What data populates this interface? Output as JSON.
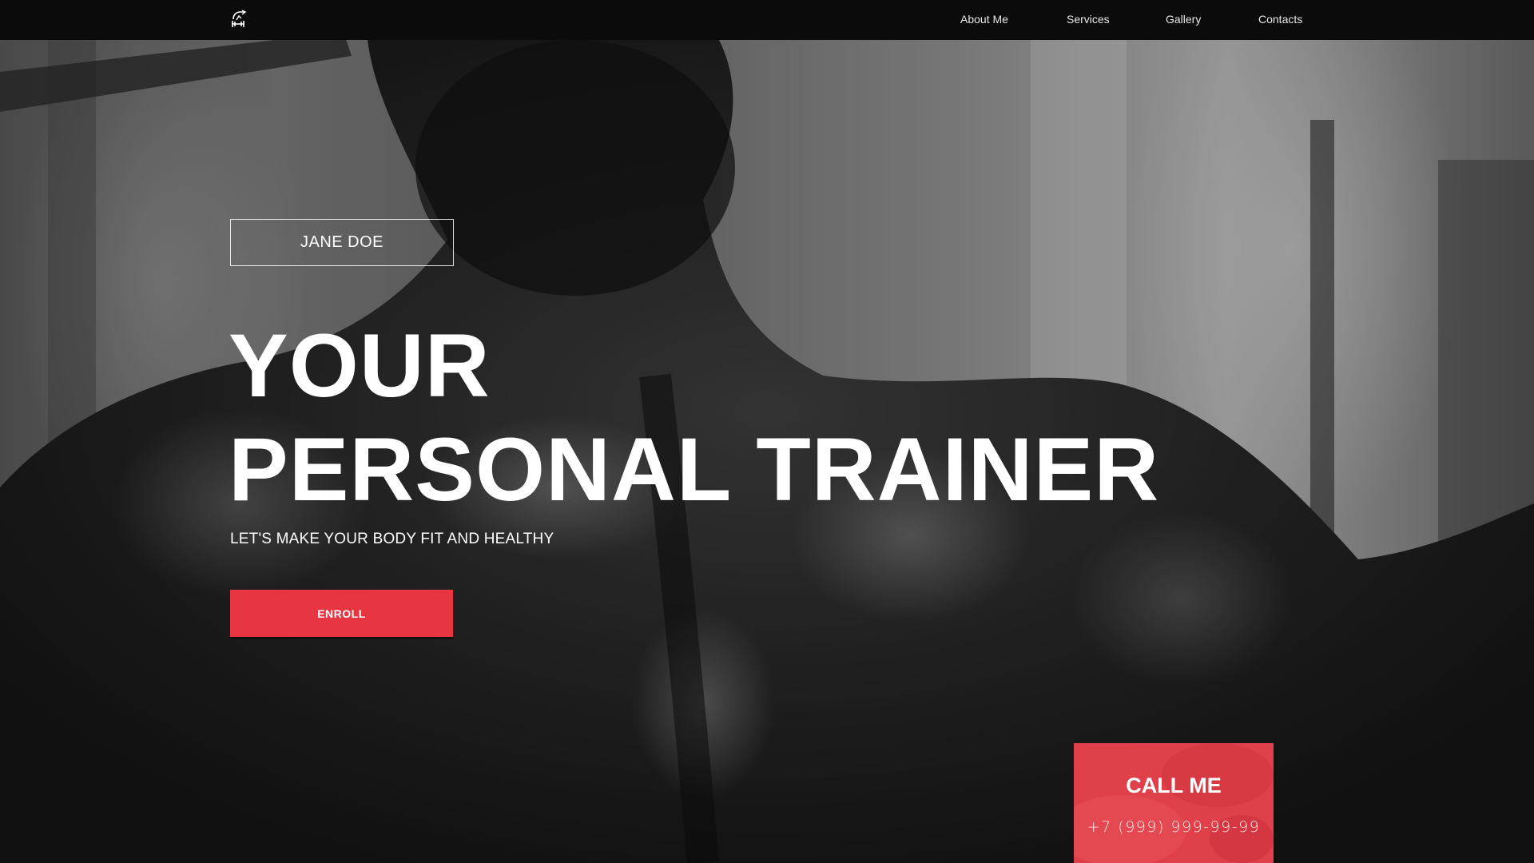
{
  "nav": {
    "logo_icon": "dumbbell-logo-icon",
    "links": [
      "About Me",
      "Services",
      "Gallery",
      "Contacts"
    ]
  },
  "hero": {
    "name_badge": "JANE DOE",
    "headline_line1": "YOUR",
    "headline_line2": "PERSONAL TRAINER",
    "subheadline": "LET'S MAKE YOUR BODY FIT AND HEALTHY",
    "cta_label": "ENROLL",
    "background_subject": "trainer-back-photo"
  },
  "call_card": {
    "title": "CALL ME",
    "phone": "+7 (999) 999-99-99"
  },
  "colors": {
    "accent": "#e73642",
    "navbar": "#0b0b0b",
    "text": "#ffffff"
  }
}
